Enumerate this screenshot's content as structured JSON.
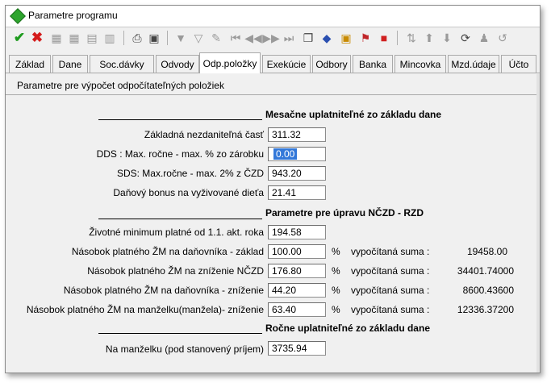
{
  "window": {
    "title": "Parametre programu"
  },
  "toolbar": {
    "icons": [
      "check-icon",
      "close-icon",
      "grid-icon",
      "grid-add-icon",
      "grid-edit-icon",
      "grid-delete-icon",
      "print-icon",
      "document-icon",
      "filter-icon",
      "filter-clear-icon",
      "filter-edit-icon",
      "first-icon",
      "prev-icon",
      "next-icon",
      "last-icon",
      "copy-icon",
      "book-icon",
      "calculator-icon",
      "flag-icon",
      "color-icon",
      "sort-icon",
      "up-icon",
      "down-icon",
      "refresh-icon",
      "person-icon",
      "undo-icon"
    ]
  },
  "tabs": [
    "Základ",
    "Dane",
    "Soc.dávky",
    "Odvody",
    "Odp.položky",
    "Exekúcie",
    "Odbory",
    "Banka",
    "Mincovka",
    "Mzd.údaje",
    "Účto"
  ],
  "active_tab": "Odp.položky",
  "panel": {
    "header": "Parametre pre výpočet odpočítateľných položiek"
  },
  "sections": {
    "monthly": {
      "title": "Mesačne uplatniteľné zo základu dane",
      "rows": [
        {
          "label": "Základná nezdaniteľná časť",
          "value": "311.32"
        },
        {
          "label": "DDS : Max. ročne - max. % zo zárobku",
          "value": "0.00"
        },
        {
          "label": "SDS: Max.ročne - max. 2% z ČZD",
          "value": "943.20"
        },
        {
          "label": "Daňový bonus na vyživované dieťa",
          "value": "21.41"
        }
      ]
    },
    "nczd": {
      "title": "Parametre pre úpravu NČZD - RZD",
      "minimum": {
        "label": "Životné minimum platné od 1.1. akt. roka",
        "value": "194.58"
      },
      "rows": [
        {
          "label": "Násobok platného ŽM na daňovníka - základ",
          "value": "100.00",
          "pct": "%",
          "calc_label": "vypočítaná suma :",
          "calc": "19458.00"
        },
        {
          "label": "Násobok platného ŽM na zníženie NČZD",
          "value": "176.80",
          "pct": "%",
          "calc_label": "vypočítaná suma :",
          "calc": "34401.74000"
        },
        {
          "label": "Násobok platného ŽM na daňovníka - zníženie",
          "value": "44.20",
          "pct": "%",
          "calc_label": "vypočítaná suma :",
          "calc": "8600.43600"
        },
        {
          "label": "Násobok platného ŽM na manželku(manžela)- zníženie",
          "value": "63.40",
          "pct": "%",
          "calc_label": "vypočítaná suma :",
          "calc": "12336.37200"
        }
      ]
    },
    "yearly": {
      "title": "Ročne uplatniteľné zo základu dane",
      "rows": [
        {
          "label": "Na manželku (pod stanovený príjem)",
          "value": "3735.94"
        }
      ]
    }
  }
}
